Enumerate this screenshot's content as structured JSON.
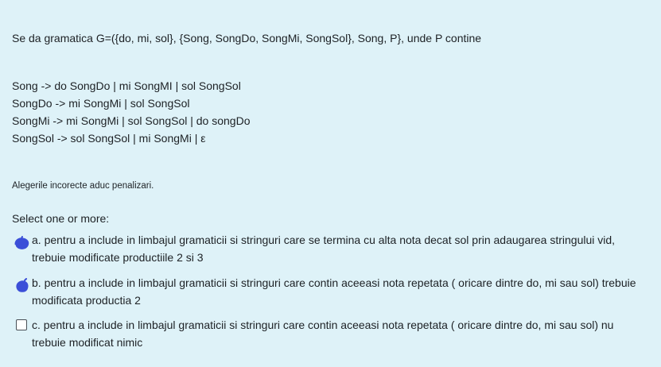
{
  "question": {
    "intro": "Se da gramatica G=({do, mi, sol}, {Song, SongDo, SongMi, SongSol}, Song, P}, unde P contine",
    "rules": [
      "Song -> do SongDo | mi SongMI | sol SongSol",
      "SongDo -> mi SongMi | sol SongSol",
      "SongMi -> mi SongMi | sol SongSol | do songDo",
      "SongSol -> sol SongSol | mi SongMi | ε"
    ],
    "note": "Alegerile incorecte aduc penalizari."
  },
  "prompt": "Select one or more:",
  "options": [
    {
      "number": "a.",
      "text": "pentru a include in limbajul  gramaticii si stringuri care se termina cu alta nota decat sol prin adaugarea stringului vid, trebuie modificate productiile 2 si 3",
      "checked": true
    },
    {
      "number": "b.",
      "text": "pentru a include in limbajul gramaticii si stringuri care contin aceeasi nota repetata ( oricare dintre do, mi sau sol) trebuie modificata productia 2",
      "checked": true
    },
    {
      "number": "c.",
      "text": "pentru a include in limbajul gramaticii si stringuri care contin aceeasi nota repetata ( oricare dintre do, mi sau sol) nu trebuie modificat nimic",
      "checked": false
    }
  ],
  "colors": {
    "background": "#def2f8",
    "text": "#1d2125",
    "scribble": "#3b4fd8"
  },
  "icons": {
    "scribble": "pen-scribble-mark",
    "checkbox": "checkbox-unchecked"
  }
}
